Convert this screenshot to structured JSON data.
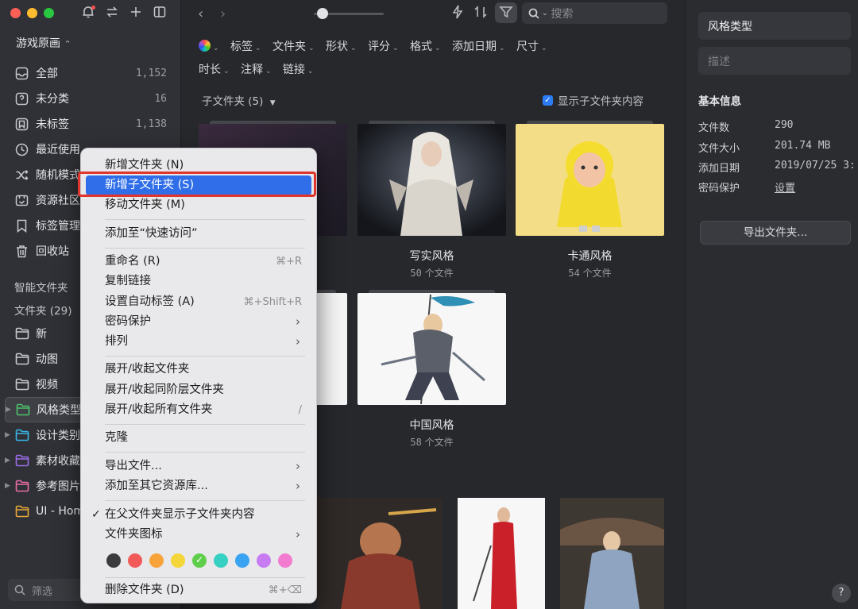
{
  "sidebar": {
    "library_name": "游戏原画",
    "nav": [
      {
        "label": "全部",
        "count": "1,152",
        "icon": "inbox-icon"
      },
      {
        "label": "未分类",
        "count": "16",
        "icon": "unsorted-icon"
      },
      {
        "label": "未标签",
        "count": "1,138",
        "icon": "untagged-icon"
      },
      {
        "label": "最近使用",
        "count": "",
        "icon": "clock-icon"
      },
      {
        "label": "随机模式",
        "count": "",
        "icon": "shuffle-icon"
      },
      {
        "label": "资源社区",
        "count": "",
        "icon": "community-icon"
      },
      {
        "label": "标签管理",
        "count": "",
        "icon": "tag-icon"
      },
      {
        "label": "回收站",
        "count": "",
        "icon": "trash-icon"
      }
    ],
    "smart_folders_label": "智能文件夹",
    "folders_label": "文件夹 (29)",
    "folders": [
      {
        "label": "新",
        "color": "#c9cacd",
        "has_children": false
      },
      {
        "label": "动图",
        "color": "#c9cacd",
        "has_children": false
      },
      {
        "label": "视频",
        "color": "#c9cacd",
        "has_children": false
      },
      {
        "label": "风格类型",
        "color": "#4cc26b",
        "has_children": true
      },
      {
        "label": "设计类别",
        "color": "#38b6e8",
        "has_children": true
      },
      {
        "label": "素材收藏",
        "color": "#9b6ee8",
        "has_children": true
      },
      {
        "label": "参考图片",
        "color": "#e86ea6",
        "has_children": true
      },
      {
        "label": "UI - Hom",
        "color": "#e8a93a",
        "has_children": false
      }
    ],
    "filter_placeholder": "筛选"
  },
  "toolbar": {
    "search_placeholder": "搜索"
  },
  "filters": [
    "标签",
    "文件夹",
    "形状",
    "评分",
    "格式",
    "添加日期",
    "尺寸",
    "时长",
    "注释",
    "链接"
  ],
  "content": {
    "subfolders_label": "子文件夹 (5)",
    "show_subfolder_label": "显示子文件夹内容",
    "cards": [
      {
        "title": "写实风格",
        "count": "50",
        "unit": "个文件"
      },
      {
        "title": "卡通风格",
        "count": "54",
        "unit": "个文件"
      },
      {
        "title": "中国风格",
        "count": "58",
        "unit": "个文件"
      }
    ]
  },
  "inspector": {
    "name": "风格类型",
    "description_placeholder": "描述",
    "section": "基本信息",
    "rows": [
      {
        "label": "文件数",
        "value": "290"
      },
      {
        "label": "文件大小",
        "value": "201.74 MB"
      },
      {
        "label": "添加日期",
        "value": "2019/07/25 3:"
      },
      {
        "label": "密码保护",
        "value": "设置"
      }
    ],
    "export_label": "导出文件夹...",
    "help_label": "?"
  },
  "context_menu": {
    "items": [
      {
        "label": "新增文件夹 (N)",
        "shortcut": ""
      },
      {
        "label": "新增子文件夹 (S)",
        "shortcut": "",
        "active": true
      },
      {
        "label": "移动文件夹 (M)",
        "shortcut": ""
      },
      {
        "label": "添加至“快速访问”",
        "shortcut": ""
      },
      {
        "label": "重命名 (R)",
        "shortcut": "⌘+R"
      },
      {
        "label": "复制链接",
        "shortcut": ""
      },
      {
        "label": "设置自动标签 (A)",
        "shortcut": "⌘+Shift+R"
      },
      {
        "label": "密码保护",
        "shortcut": "",
        "submenu": true
      },
      {
        "label": "排列",
        "shortcut": "",
        "submenu": true
      },
      {
        "label": "展开/收起文件夹",
        "shortcut": ""
      },
      {
        "label": "展开/收起同阶层文件夹",
        "shortcut": ""
      },
      {
        "label": "展开/收起所有文件夹",
        "shortcut": "/"
      },
      {
        "label": "克隆",
        "shortcut": ""
      },
      {
        "label": "导出文件...",
        "shortcut": "",
        "submenu": true
      },
      {
        "label": "添加至其它资源库...",
        "shortcut": "",
        "submenu": true
      },
      {
        "label": "在父文件夹显示子文件夹内容",
        "shortcut": "",
        "checked": true
      },
      {
        "label": "文件夹图标",
        "shortcut": "",
        "submenu": true
      },
      {
        "label": "删除文件夹 (D)",
        "shortcut": "⌘+⌫"
      }
    ],
    "swatch_colors": [
      "#3b3b3d",
      "#f25a5a",
      "#f7a33a",
      "#f5d63a",
      "#5fcf4b",
      "#36d1c2",
      "#3aa3f2",
      "#c77cf2",
      "#f27ccf"
    ],
    "selected_swatch": 4,
    "check_mark": "✓",
    "submenu_mark": "›"
  }
}
